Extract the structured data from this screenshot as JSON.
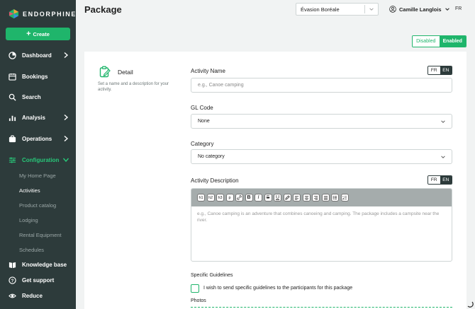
{
  "brand": {
    "name": "ENDORPHINE"
  },
  "sidebar": {
    "create_label": "Create",
    "items": [
      {
        "label": "Dashboard",
        "icon": "dashboard-icon"
      },
      {
        "label": "Bookings",
        "icon": "calendar-icon"
      },
      {
        "label": "Search",
        "icon": "search-icon"
      },
      {
        "label": "Analysis",
        "icon": "chart-icon"
      },
      {
        "label": "Operations",
        "icon": "operations-icon"
      },
      {
        "label": "Configuration",
        "icon": "sliders-icon"
      }
    ],
    "config_sub": [
      "My Home Page",
      "Activities",
      "Product catalog",
      "Lodging",
      "Rental Equipment",
      "Schedules"
    ],
    "bottom": [
      {
        "label": "Knowledge base",
        "icon": "book-icon"
      },
      {
        "label": "Get support",
        "icon": "help-icon"
      },
      {
        "label": "Reduce",
        "icon": "eye-icon"
      }
    ]
  },
  "header": {
    "title": "Package",
    "company": "Évasion Boréale",
    "user": "Camille Langlois",
    "lang": "FR"
  },
  "status": {
    "disabled": "Disabled",
    "enabled": "Enabled"
  },
  "detail": {
    "title": "Detail",
    "description": "Set a name and a description for your activity."
  },
  "form": {
    "activity_name_label": "Activity Name",
    "activity_name_placeholder": "e.g., Canoe camping",
    "gl_code_label": "GL Code",
    "gl_code_value": "None",
    "category_label": "Category",
    "category_value": "No category",
    "description_label": "Activity Description",
    "description_placeholder": "e.g., Canoe camping is an adventure that combines canoeing and camping. The package includes a campsite near the river.",
    "lang_fr": "FR",
    "lang_en": "EN",
    "specific_label": "Specific Guidelines",
    "guidelines_checkbox": "I wish to send specific guidelines to the participants for this package",
    "photos_label": "Photos"
  },
  "toolbar": [
    "h1",
    "h2",
    "h3",
    "p",
    "link",
    "B",
    "I",
    "S",
    "U",
    "pen",
    "align-left",
    "align-center",
    "align-right",
    "align-justify",
    "bullet-list",
    "numbered-list"
  ],
  "colors": {
    "accent": "#1fb56b",
    "sidebar": "#2d3b3b"
  }
}
